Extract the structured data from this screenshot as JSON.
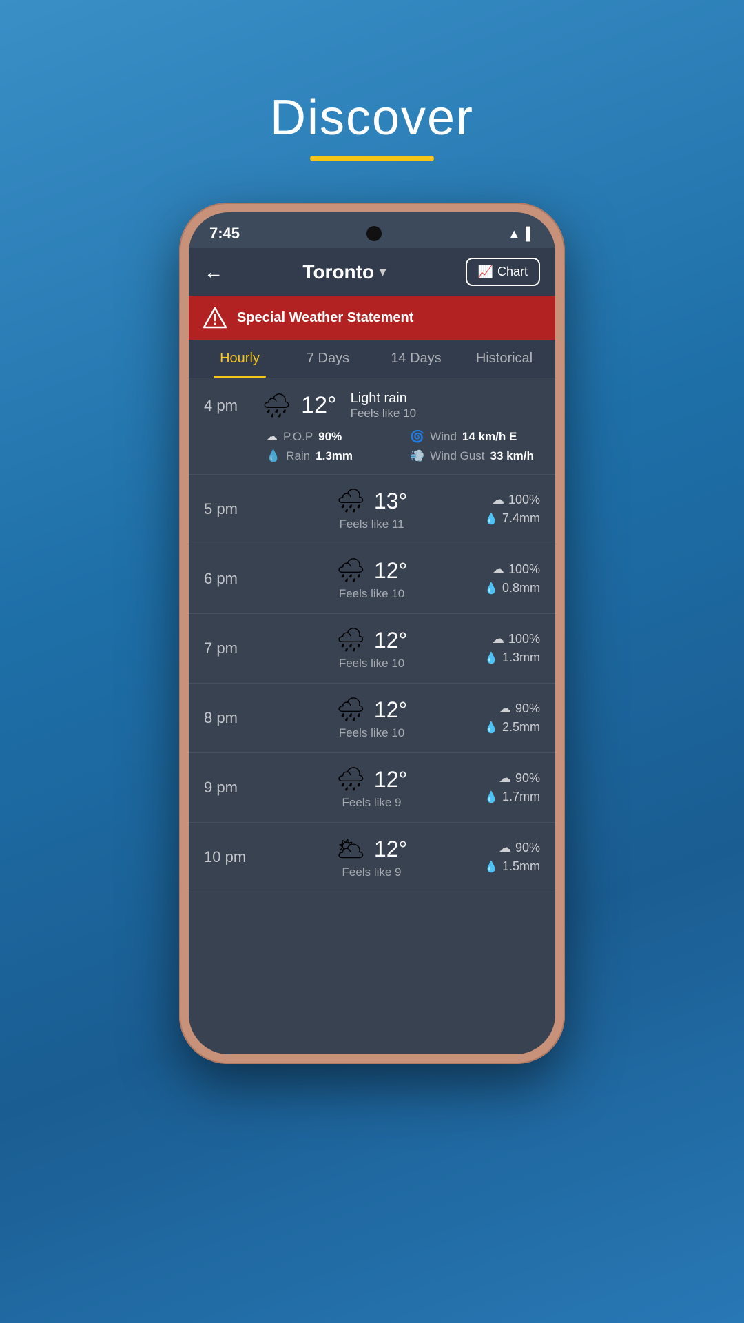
{
  "page": {
    "title": "Discover",
    "underline_color": "#f5c518"
  },
  "status_bar": {
    "time": "7:45",
    "wifi": "▲",
    "battery": "▌"
  },
  "header": {
    "back_label": "←",
    "city": "Toronto",
    "city_chevron": "▾",
    "chart_label": "Chart"
  },
  "alert": {
    "text": "Special Weather Statement"
  },
  "tabs": [
    {
      "id": "hourly",
      "label": "Hourly",
      "active": true
    },
    {
      "id": "7days",
      "label": "7 Days",
      "active": false
    },
    {
      "id": "14days",
      "label": "14 Days",
      "active": false
    },
    {
      "id": "historical",
      "label": "Historical",
      "active": false
    }
  ],
  "hours": [
    {
      "time": "4 pm",
      "icon": "🌧",
      "temp": "12°",
      "condition": "Light rain",
      "feels_like": "Feels like 10",
      "expanded": true,
      "pop": "90%",
      "rain": "1.3mm",
      "wind": "14 km/h E",
      "wind_gust": "33 km/h"
    },
    {
      "time": "5 pm",
      "icon": "🌧",
      "temp": "13°",
      "feels_like": "Feels like 11",
      "pop": "100%",
      "rain": "7.4mm"
    },
    {
      "time": "6 pm",
      "icon": "🌧",
      "temp": "12°",
      "feels_like": "Feels like 10",
      "pop": "100%",
      "rain": "0.8mm"
    },
    {
      "time": "7 pm",
      "icon": "🌧",
      "temp": "12°",
      "feels_like": "Feels like 10",
      "pop": "100%",
      "rain": "1.3mm"
    },
    {
      "time": "8 pm",
      "icon": "🌧",
      "temp": "12°",
      "feels_like": "Feels like 10",
      "pop": "90%",
      "rain": "2.5mm"
    },
    {
      "time": "9 pm",
      "icon": "🌧",
      "temp": "12°",
      "feels_like": "Feels like 9",
      "pop": "90%",
      "rain": "1.7mm"
    },
    {
      "time": "10 pm",
      "icon": "🌥",
      "temp": "12°",
      "feels_like": "Feels like 9",
      "pop": "90%",
      "rain": "1.5mm"
    }
  ]
}
